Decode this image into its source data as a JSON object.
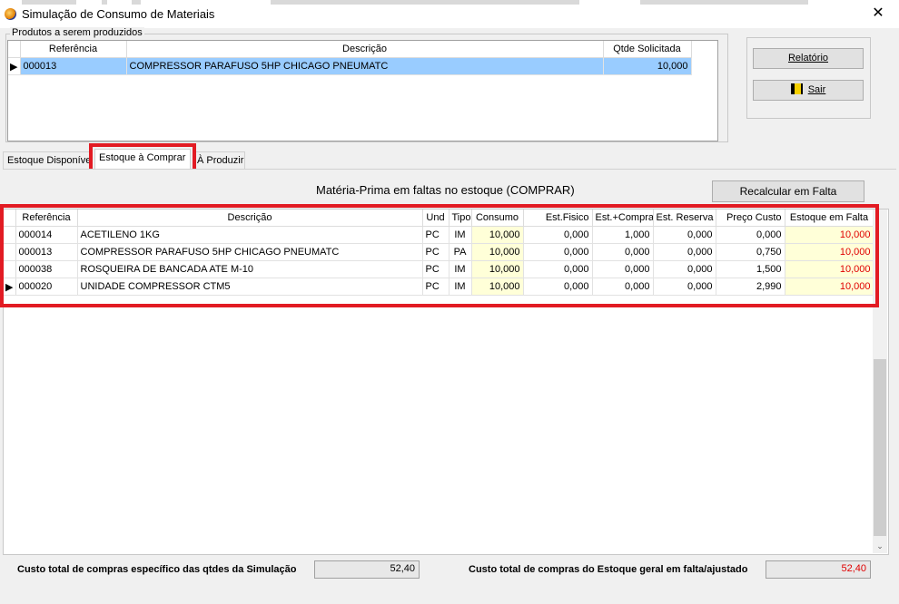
{
  "window": {
    "title": "Simulação de Consumo de Materiais",
    "close_glyph": "✕"
  },
  "products": {
    "group_label": "Produtos a serem produzidos",
    "columns": [
      "Referência",
      "Descrição",
      "Qtde Solicitada"
    ],
    "rows": [
      [
        "000013",
        "COMPRESSOR PARAFUSO 5HP CHICAGO PNEUMATC",
        "10,000"
      ]
    ]
  },
  "buttons": {
    "report": "Relatório",
    "exit": "Sair",
    "recalc": "Recalcular em Falta"
  },
  "tabs": [
    "Estoque Disponível",
    "Estoque à Comprar",
    "À Produzir"
  ],
  "panel": {
    "heading": "Matéria-Prima em faltas no estoque (COMPRAR)"
  },
  "materials": {
    "columns": [
      "Referência",
      "Descrição",
      "Und",
      "Tipo",
      "Consumo",
      "Est.Fisico",
      "Est.+Compra",
      "Est. Reserva",
      "Preço Custo",
      "Estoque em Falta"
    ],
    "rows": [
      [
        "000014",
        "ACETILENO 1KG",
        "PC",
        "IM",
        "10,000",
        "0,000",
        "1,000",
        "0,000",
        "0,000",
        "10,000"
      ],
      [
        "000013",
        "COMPRESSOR PARAFUSO 5HP CHICAGO PNEUMATC",
        "PC",
        "PA",
        "10,000",
        "0,000",
        "0,000",
        "0,000",
        "0,750",
        "10,000"
      ],
      [
        "000038",
        "ROSQUEIRA DE BANCADA ATE M-10",
        "PC",
        "IM",
        "10,000",
        "0,000",
        "0,000",
        "0,000",
        "1,500",
        "10,000"
      ],
      [
        "000020",
        "UNIDADE COMPRESSOR CTM5",
        "PC",
        "IM",
        "10,000",
        "0,000",
        "0,000",
        "0,000",
        "2,990",
        "10,000"
      ]
    ],
    "current_row_index": 3
  },
  "footer": {
    "label_sim": "Custo total de compras específico das qtdes da Simulação",
    "value_sim": "52,40",
    "label_general": "Custo total de compras do Estoque geral em falta/ajustado",
    "value_general": "52,40"
  },
  "colors": {
    "highlight": "#e21b23",
    "selection": "#99ccff",
    "shortage_text": "#e00000",
    "consumption_bg": "#ffffd8"
  }
}
